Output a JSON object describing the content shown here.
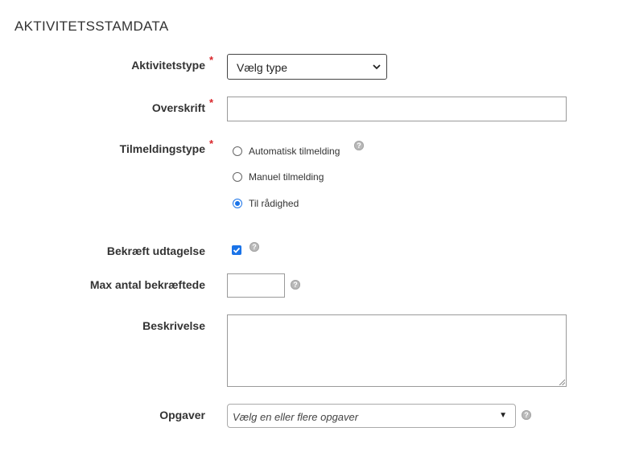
{
  "section": {
    "title": "AKTIVITETSSTAMDATA"
  },
  "form": {
    "required_mark": "*",
    "help_mark": "?",
    "activity_type": {
      "label": "Aktivitetstype",
      "selected": "Vælg type"
    },
    "heading": {
      "label": "Overskrift",
      "value": ""
    },
    "signup_type": {
      "label": "Tilmeldingstype",
      "options": [
        "Automatisk tilmelding",
        "Manuel tilmelding",
        "Til rådighed"
      ],
      "selected": "Til rådighed"
    },
    "confirm_exclusion": {
      "label": "Bekræft udtagelse",
      "checked": true
    },
    "max_confirmed": {
      "label": "Max antal bekræftede",
      "value": ""
    },
    "description": {
      "label": "Beskrivelse",
      "value": ""
    },
    "tasks": {
      "label": "Opgaver",
      "placeholder": "Vælg en eller flere opgaver",
      "caret": "▼"
    }
  },
  "colors": {
    "accent": "#1a73e8",
    "required": "#d9252a"
  },
  "icons": {
    "help": "help-icon",
    "dropdown": "chevron-down-icon"
  }
}
